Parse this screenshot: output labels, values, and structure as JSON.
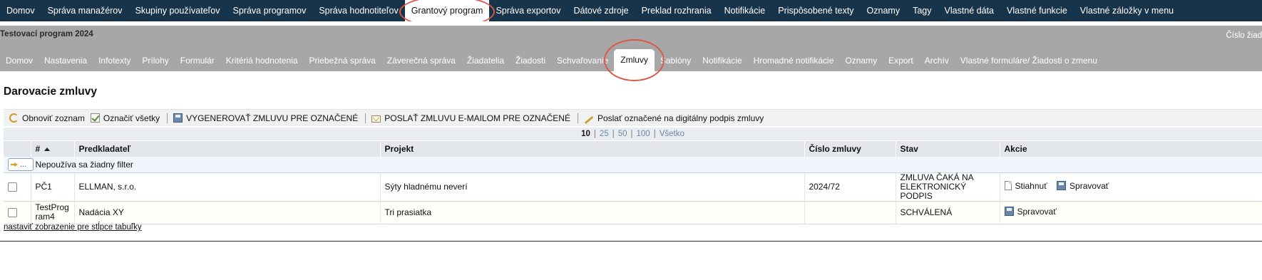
{
  "top_nav": {
    "items": [
      {
        "label": "Domov"
      },
      {
        "label": "Správa manažérov"
      },
      {
        "label": "Skupiny používateľov"
      },
      {
        "label": "Správa programov"
      },
      {
        "label": "Správa hodnotiteľov"
      },
      {
        "label": "Grantový program",
        "active": true
      },
      {
        "label": "Správa exportov"
      },
      {
        "label": "Dátové zdroje"
      },
      {
        "label": "Preklad rozhrania"
      },
      {
        "label": "Notifikácie"
      },
      {
        "label": "Prispôsobené texty"
      },
      {
        "label": "Oznamy"
      },
      {
        "label": "Tagy"
      },
      {
        "label": "Vlastné dáta"
      },
      {
        "label": "Vlastné funkcie"
      },
      {
        "label": "Vlastné záložky v menu"
      }
    ]
  },
  "program": {
    "title": "Testovací program 2024",
    "number_label": "Číslo žiad"
  },
  "sub_nav": {
    "items": [
      {
        "label": "Domov"
      },
      {
        "label": "Nastavenia"
      },
      {
        "label": "Infotexty"
      },
      {
        "label": "Prílohy"
      },
      {
        "label": "Formulár"
      },
      {
        "label": "Kritériá hodnotenia"
      },
      {
        "label": "Priebežná správa"
      },
      {
        "label": "Záverečná správa"
      },
      {
        "label": "Žiadatelia"
      },
      {
        "label": "Žiadosti"
      },
      {
        "label": "Schvaľovanie"
      },
      {
        "label": "Zmluvy",
        "active": true
      },
      {
        "label": "Šablóny"
      },
      {
        "label": "Notifikácie"
      },
      {
        "label": "Hromadné notifikácie"
      },
      {
        "label": "Oznamy"
      },
      {
        "label": "Export"
      },
      {
        "label": "Archív"
      },
      {
        "label": "Vlastné formuláre/ Žiadosti o zmenu"
      }
    ]
  },
  "page": {
    "title": "Darovacie zmluvy"
  },
  "toolbar": {
    "refresh_label": "Obnoviť zoznam",
    "select_all_label": "Označiť všetky",
    "generate_label": "VYGENEROVAŤ ZMLUVU PRE OZNAČENÉ",
    "email_label": "POSLAŤ ZMLUVU E-MAILOM PRE OZNAČENÉ",
    "sign_label": "Poslať označené na digitálny podpis zmluvy"
  },
  "pager": {
    "options": [
      "10",
      "25",
      "50",
      "100",
      "Všetko"
    ],
    "current": "10",
    "separator": "|"
  },
  "table": {
    "headers": [
      "",
      "#",
      "Predkladateľ",
      "Projekt",
      "Číslo zmluvy",
      "Stav",
      "Akcie"
    ],
    "filter_button_label": "...",
    "filter_text": "Nepoužíva sa žiadny filter",
    "rows": [
      {
        "id": "PČ1",
        "applicant": "ELLMAN, s.r.o.",
        "project": "Sýty hladnému neverí",
        "contract_no": "2024/72",
        "status": "ZMLUVA ČAKÁ NA ELEKTRONICKÝ PODPIS",
        "action_download": "Stiahnuť",
        "action_manage": "Spravovať"
      },
      {
        "id": "TestProgram4",
        "applicant": "Nadácia XY",
        "project": "Tri prasiatka",
        "contract_no": "",
        "status": "SCHVÁLENÁ",
        "action_manage": "Spravovať"
      }
    ]
  },
  "footer": {
    "columns_link": "nastaviť zobrazenie pre stĺpce tabuľky"
  },
  "colors": {
    "top_nav_bg": "#17344a",
    "header_bg": "#a7a7a7",
    "highlight_ring": "#d9584a"
  }
}
